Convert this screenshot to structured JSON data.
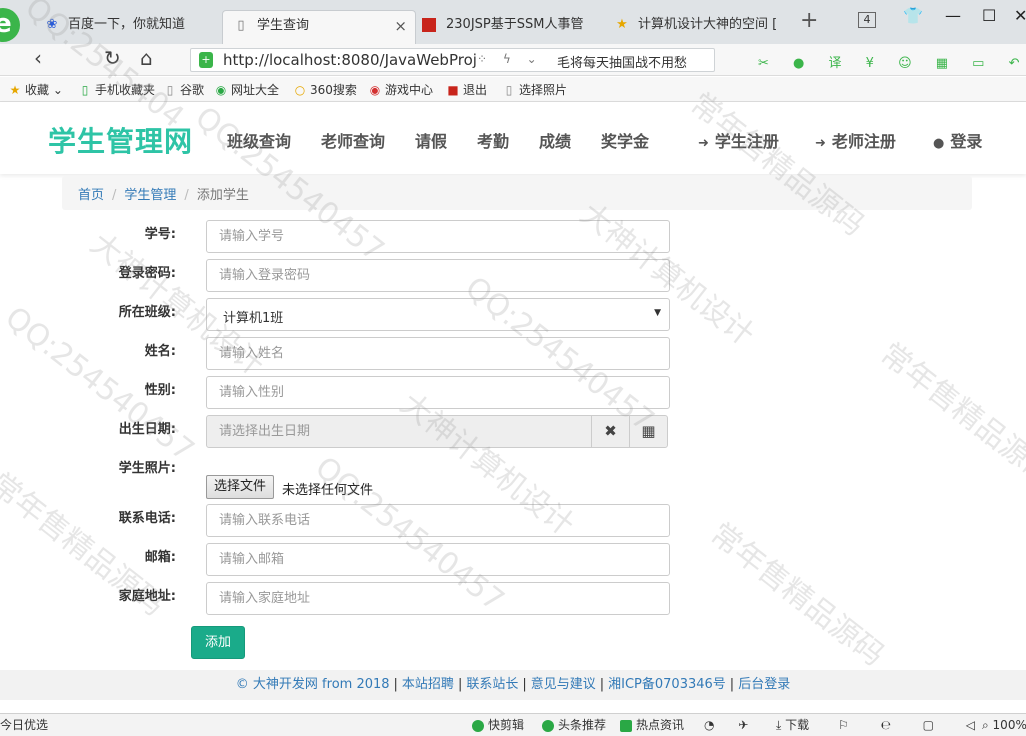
{
  "browser": {
    "logo_letter": "e",
    "tabs": [
      {
        "title": "百度一下，你就知道",
        "icon": "baidu-paw-icon"
      },
      {
        "title": "学生查询",
        "icon": "page-icon",
        "active": true
      },
      {
        "title": "230JSP基于SSM人事管",
        "icon": "red-square-icon"
      },
      {
        "title": "计算机设计大神的空间 [",
        "icon": "star-icon"
      }
    ],
    "tab_count": "4",
    "address_url": "http://localhost:8080/JavaWebProj",
    "address_news": "毛将每天抽国战不用愁",
    "ext_icon_labels": [
      "译"
    ],
    "bookmarks": [
      "收藏",
      "手机收藏夹",
      "谷歌",
      "网址大全",
      "360搜索",
      "游戏中心",
      "退出",
      "选择照片"
    ]
  },
  "site": {
    "brand": "学生管理网",
    "menu": [
      "班级查询",
      "老师查询",
      "请假",
      "考勤",
      "成绩",
      "奖学金"
    ],
    "right_menu": [
      {
        "label": "学生注册",
        "icon": "sign-in-icon"
      },
      {
        "label": "老师注册",
        "icon": "sign-in-icon"
      },
      {
        "label": "登录",
        "icon": "user-icon"
      }
    ]
  },
  "breadcrumb": {
    "home": "首页",
    "section": "学生管理",
    "current": "添加学生",
    "separator": "/"
  },
  "form": {
    "student_no": {
      "label": "学号:",
      "placeholder": "请输入学号"
    },
    "password": {
      "label": "登录密码:",
      "placeholder": "请输入登录密码"
    },
    "class": {
      "label": "所在班级:",
      "value": "计算机1班"
    },
    "name": {
      "label": "姓名:",
      "placeholder": "请输入姓名"
    },
    "gender": {
      "label": "性别:",
      "placeholder": "请输入性别"
    },
    "birthday": {
      "label": "出生日期:",
      "placeholder": "请选择出生日期"
    },
    "photo": {
      "label": "学生照片:",
      "button": "选择文件",
      "status": "未选择任何文件"
    },
    "phone": {
      "label": "联系电话:",
      "placeholder": "请输入联系电话"
    },
    "email": {
      "label": "邮箱:",
      "placeholder": "请输入邮箱"
    },
    "address": {
      "label": "家庭地址:",
      "placeholder": "请输入家庭地址"
    },
    "submit": "添加"
  },
  "footer": {
    "links": [
      "© 大神开发网 from 2018",
      "本站招聘",
      "联系站长",
      "意见与建议",
      "湘ICP备0703346号",
      "后台登录"
    ],
    "separator": "|"
  },
  "statusbar": {
    "left": "今日优选",
    "items": [
      "快剪辑",
      "头条推荐",
      "热点资讯",
      "下载"
    ],
    "zoom": "100%"
  },
  "watermark": {
    "texts": [
      "QQ:2545404",
      "QQ:254540457",
      "大神计算机设计",
      "常年售精品源码",
      "QQ:254540457",
      "大神计算机设计",
      "常年售精品源码",
      "QQ:254540457",
      "常年售精品源码",
      "大神计算机设计",
      "QQ:254540457",
      "常年售精品源码"
    ]
  },
  "colors": {
    "brand": "#2ec4a6",
    "primary_button": "#1aab8a",
    "link": "#337ab7"
  }
}
